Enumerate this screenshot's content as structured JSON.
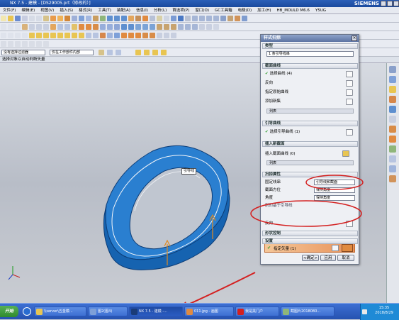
{
  "window": {
    "title": "NX 7.5 - 建模 - [DS29005.prt（修改的）]",
    "brand": "SIEMENS"
  },
  "menu": [
    "文件(F)",
    "编辑(E)",
    "视图(V)",
    "插入(S)",
    "格式(R)",
    "工具(T)",
    "装配(A)",
    "信息(I)",
    "分析(L)",
    "首选项(P)",
    "窗口(O)",
    "GC工具箱",
    "电极(D)",
    "加工(H)",
    "HB_MOULD M6.6",
    "Y5UG"
  ],
  "filter": {
    "type_filter": "没有选择过滤器",
    "scope": "仅在工作部件内部"
  },
  "prompt": "选择对象以自动判断矢量",
  "dialog": {
    "title": "样式扫掠",
    "close": "×",
    "sections": {
      "type": "类型",
      "section_curves": "截面曲线",
      "guide_curves": "引导曲线",
      "insert_section": "插入新截面",
      "sweep_props": "扫掠属性",
      "shape_control": "形状控制",
      "settings": "设置",
      "preview": "预览"
    },
    "type_value": "1 条引导线串",
    "select_curve": "选择曲线 (4)",
    "reverse": "反向",
    "specify_origin": "指定原始曲线",
    "add_new_set": "添加新集",
    "list": "列表",
    "select_guide": "选择引导曲线 (1)",
    "insert_section_label": "插入截面曲线 (0)",
    "fixed_line_label": "固定线串",
    "fixed_line_value": "引导线和截面",
    "section_orient_label": "截面方位",
    "section_orient_value": "保持角度",
    "angle_label": "角度",
    "angle_value": "保持角度",
    "aligned": "刮的基于引导线",
    "specify_vector": "指定矢量 (1)",
    "reverse2": "反向",
    "ok": "<确定>",
    "apply": "应用",
    "cancel": "取消"
  },
  "viewport": {
    "callout": "引导线"
  },
  "taskbar": {
    "start": "开始",
    "tasks": [
      "\\\\server\\五金模...",
      "图2(图4)",
      "NX 7.5 - 建模 -...",
      "011.jpg - 画图",
      "我是黑门户",
      "截图片2018080..."
    ],
    "time": "15:35",
    "date": "2018/8/29"
  },
  "colors": {
    "part_blue": "#1a72c8",
    "arrow_red": "#d42020",
    "dialog_title": "#5d74a3",
    "highlight": "#e8925a"
  }
}
